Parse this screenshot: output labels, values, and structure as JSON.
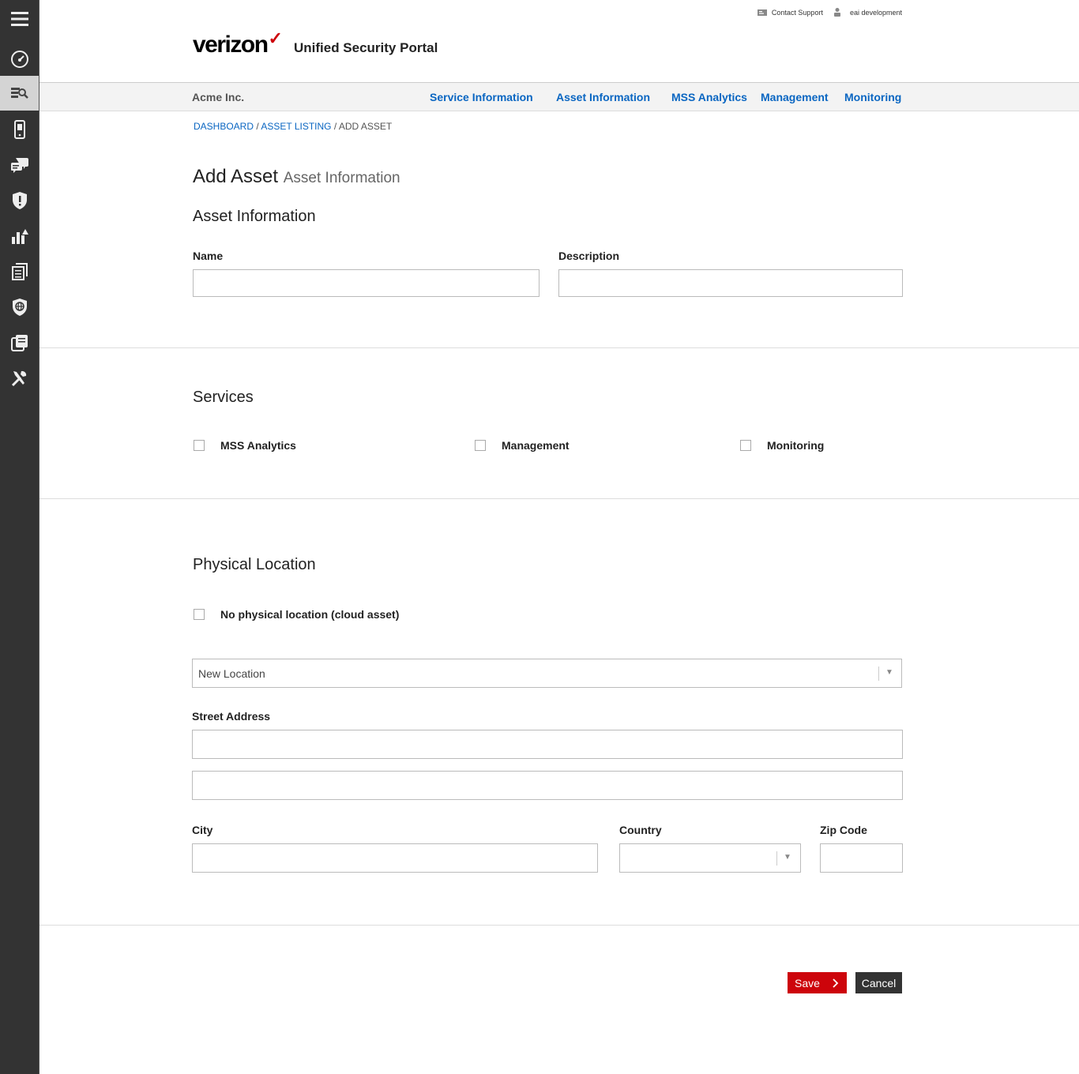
{
  "sidebar": {
    "items": [
      {
        "icon": "hamburger-menu-icon"
      },
      {
        "icon": "dashboard-gauge-icon"
      },
      {
        "icon": "asset-search-icon"
      },
      {
        "icon": "mobile-device-icon"
      },
      {
        "icon": "chat-icon"
      },
      {
        "icon": "shield-alert-icon"
      },
      {
        "icon": "analytics-chart-icon"
      },
      {
        "icon": "documents-icon"
      },
      {
        "icon": "globe-shield-icon"
      },
      {
        "icon": "reports-icon"
      },
      {
        "icon": "tools-icon"
      }
    ],
    "active_index": 2
  },
  "top_links": {
    "contact_support": "Contact Support",
    "user": "eai development"
  },
  "logo": {
    "brand": "verizon",
    "check": "✓",
    "portal": "Unified Security Portal"
  },
  "navbar": {
    "company": "Acme Inc.",
    "links": [
      "Service Information",
      "Asset Information",
      "MSS Analytics",
      "Management",
      "Monitoring"
    ]
  },
  "breadcrumb": {
    "dashboard": "DASHBOARD",
    "asset_listing": "ASSET LISTING",
    "current": "ADD ASSET",
    "sep": "/"
  },
  "page": {
    "title": "Add Asset",
    "subtitle": "Asset Information"
  },
  "asset_info": {
    "heading": "Asset Information",
    "name_label": "Name",
    "name_value": "",
    "description_label": "Description",
    "description_value": ""
  },
  "services": {
    "heading": "Services",
    "options": [
      {
        "label": "MSS Analytics",
        "checked": false
      },
      {
        "label": "Management",
        "checked": false
      },
      {
        "label": "Monitoring",
        "checked": false
      }
    ]
  },
  "location": {
    "heading": "Physical Location",
    "cloud_label": "No physical location (cloud asset)",
    "cloud_checked": false,
    "location_select": "New Location",
    "street_label": "Street Address",
    "street1": "",
    "street2": "",
    "city_label": "City",
    "city_value": "",
    "country_label": "Country",
    "country_value": "",
    "zip_label": "Zip Code",
    "zip_value": ""
  },
  "actions": {
    "save": "Save",
    "cancel": "Cancel"
  },
  "colors": {
    "brand_red": "#cd040b",
    "link_blue": "#0a66c2",
    "sidebar_bg": "#333333"
  }
}
